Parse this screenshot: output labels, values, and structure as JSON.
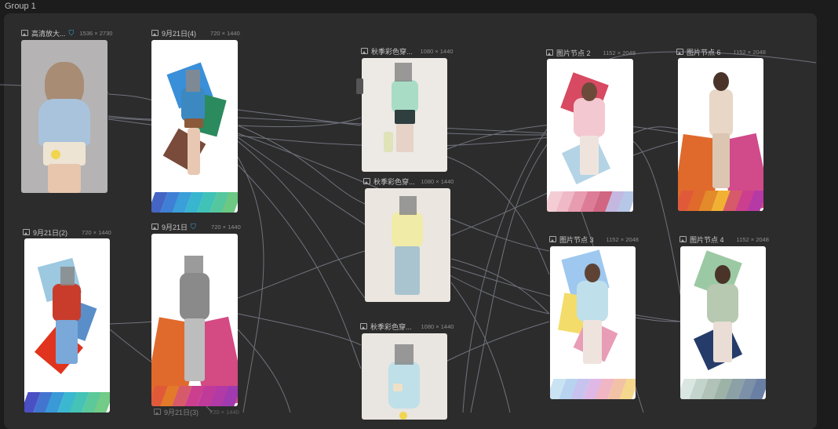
{
  "group": {
    "label": "Group 1"
  },
  "nodes": [
    {
      "id": "n1",
      "title": "高清放大...",
      "dims": "1536 × 2730",
      "verified": true
    },
    {
      "id": "n2",
      "title": "9月21日(4)",
      "dims": "720 × 1440",
      "verified": false
    },
    {
      "id": "n3",
      "title": "秋季彩色穿...",
      "dims": "1080 × 1440",
      "verified": false
    },
    {
      "id": "n4",
      "title": "图片节点 2",
      "dims": "1152 × 2048",
      "verified": false
    },
    {
      "id": "n5",
      "title": "图片节点 6",
      "dims": "1152 × 2048",
      "verified": false
    },
    {
      "id": "n6",
      "title": "秋季彩色穿...",
      "dims": "1080 × 1440",
      "verified": false
    },
    {
      "id": "n7",
      "title": "9月21日(2)",
      "dims": "720 × 1440",
      "verified": false
    },
    {
      "id": "n8",
      "title": "9月21日",
      "dims": "720 × 1440",
      "verified": true
    },
    {
      "id": "n9",
      "title": "图片节点 3",
      "dims": "1152 × 2048",
      "verified": false
    },
    {
      "id": "n10",
      "title": "图片节点 4",
      "dims": "1152 × 2048",
      "verified": false
    },
    {
      "id": "n11",
      "title": "秋季彩色穿...",
      "dims": "1080 × 1440",
      "verified": false
    },
    {
      "id": "n12",
      "title": "9月21日(3)",
      "dims": "720 × 1440",
      "verified": false
    }
  ],
  "colors": {
    "canvas": "#1c1c1c",
    "group_frame": "#2c2c2c",
    "wire": "#7d7f8c",
    "verified_badge": "#39a9e6"
  },
  "icons": {
    "node_type": "image-icon",
    "verified": "shield-check-icon"
  }
}
